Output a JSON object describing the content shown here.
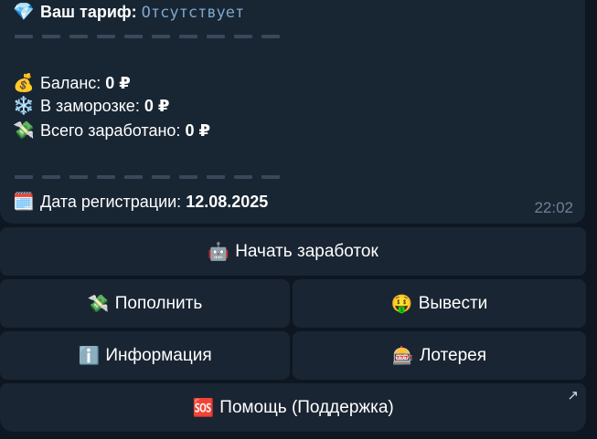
{
  "message": {
    "tariff_label": "Ваш тариф:",
    "tariff_value": "Отсутствует",
    "balance_label": "Баланс:",
    "balance_value": "0 ₽",
    "frozen_label": "В заморозке:",
    "frozen_value": "0 ₽",
    "earned_label": "Всего заработано:",
    "earned_value": "0 ₽",
    "reg_label": "Дата регистрации:",
    "reg_value": "12.08.2025",
    "time": "22:02"
  },
  "icons": {
    "diamond": "💎",
    "money_bag": "💰",
    "snowflake": "❄️",
    "money_wings": "💸",
    "calendar": "🗓️"
  },
  "keyboard": {
    "start": {
      "icon": "🤖",
      "label": "Начать заработок"
    },
    "deposit": {
      "icon": "💸",
      "label": "Пополнить"
    },
    "withdraw": {
      "icon": "🤑",
      "label": "Вывести"
    },
    "info": {
      "icon": "ℹ️",
      "label": "Информация"
    },
    "lottery": {
      "icon": "🎰",
      "label": "Лотерея"
    },
    "help": {
      "icon": "🆘",
      "label": "Помощь (Поддержка)",
      "corner_icon": "↗"
    }
  }
}
